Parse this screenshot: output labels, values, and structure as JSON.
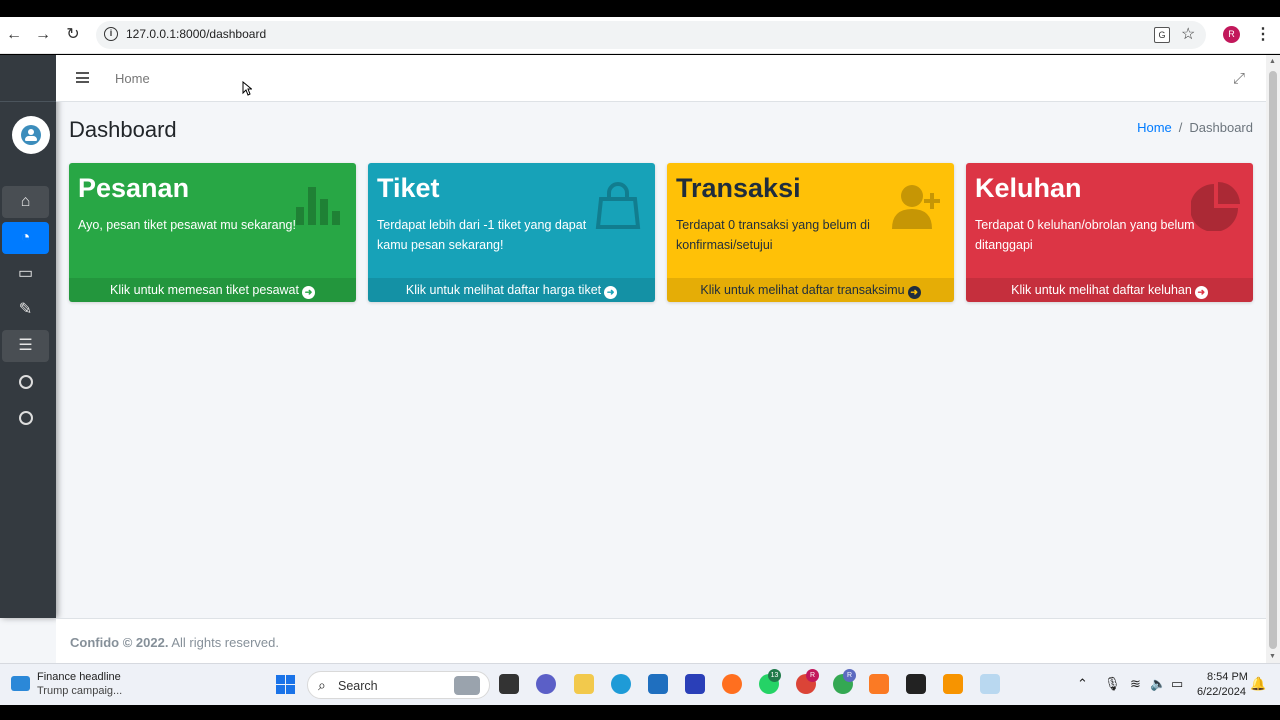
{
  "browser": {
    "url": "127.0.0.1:8000/dashboard",
    "profile_initial": "R",
    "translate_label": "G"
  },
  "navbar": {
    "home_link": "Home"
  },
  "header": {
    "title": "Dashboard",
    "breadcrumb_home": "Home",
    "breadcrumb_sep": "/",
    "breadcrumb_current": "Dashboard"
  },
  "cards": [
    {
      "title": "Pesanan",
      "text": "Ayo, pesan tiket pesawat mu sekarang!",
      "link": "Klik untuk memesan tiket pesawat",
      "color": "#28a745",
      "icon": "bar-chart-icon"
    },
    {
      "title": "Tiket",
      "text": "Terdapat lebih dari -1 tiket yang dapat kamu pesan sekarang!",
      "link": "Klik untuk melihat daftar harga tiket",
      "color": "#17a2b8",
      "icon": "shopping-bag-icon"
    },
    {
      "title": "Transaksi",
      "text": "Terdapat 0 transaksi yang belum di konfirmasi/setujui",
      "link": "Klik untuk melihat daftar transaksimu",
      "color": "#ffc107",
      "icon": "user-plus-icon"
    },
    {
      "title": "Keluhan",
      "text": "Terdapat 0 keluhan/obrolan yang belum ditanggapi",
      "link": "Klik untuk melihat daftar keluhan",
      "color": "#dc3545",
      "icon": "pie-chart-icon"
    }
  ],
  "footer": {
    "brand": "Confido © 2022.",
    "rights": "All rights reserved."
  },
  "taskbar": {
    "widget_title": "Finance headline",
    "widget_sub": "Trump campaig...",
    "search_placeholder": "Search",
    "whatsapp_badge": "13",
    "chrome_badge_1": "R",
    "chrome_badge_2": "R",
    "time": "8:54 PM",
    "date": "6/22/2024"
  }
}
